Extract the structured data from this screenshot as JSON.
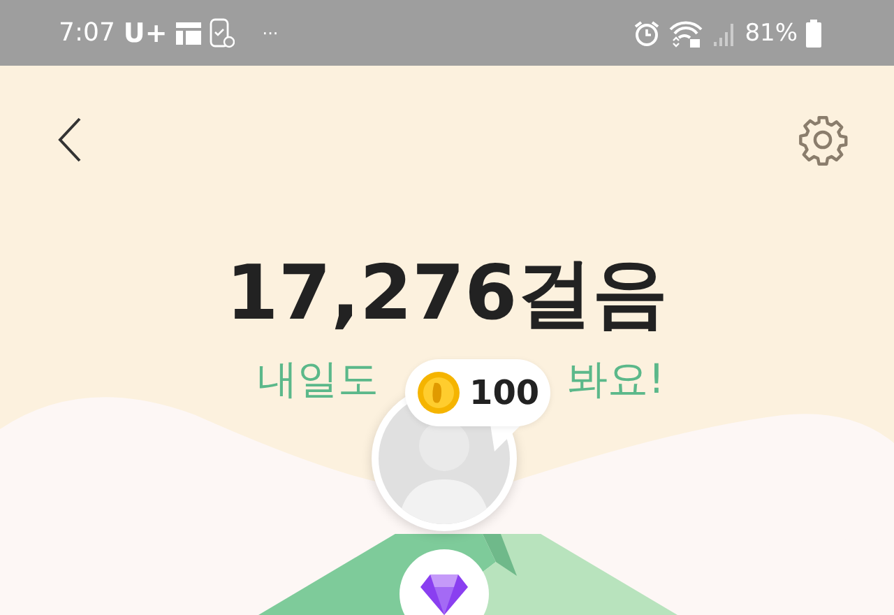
{
  "status_bar": {
    "time": "7:07",
    "carrier": "U+",
    "more": "···",
    "battery": "81%"
  },
  "steps": "17,276걸음",
  "message_parts": [
    "내일도",
    "봐요!"
  ],
  "reward": {
    "amount": "100"
  }
}
